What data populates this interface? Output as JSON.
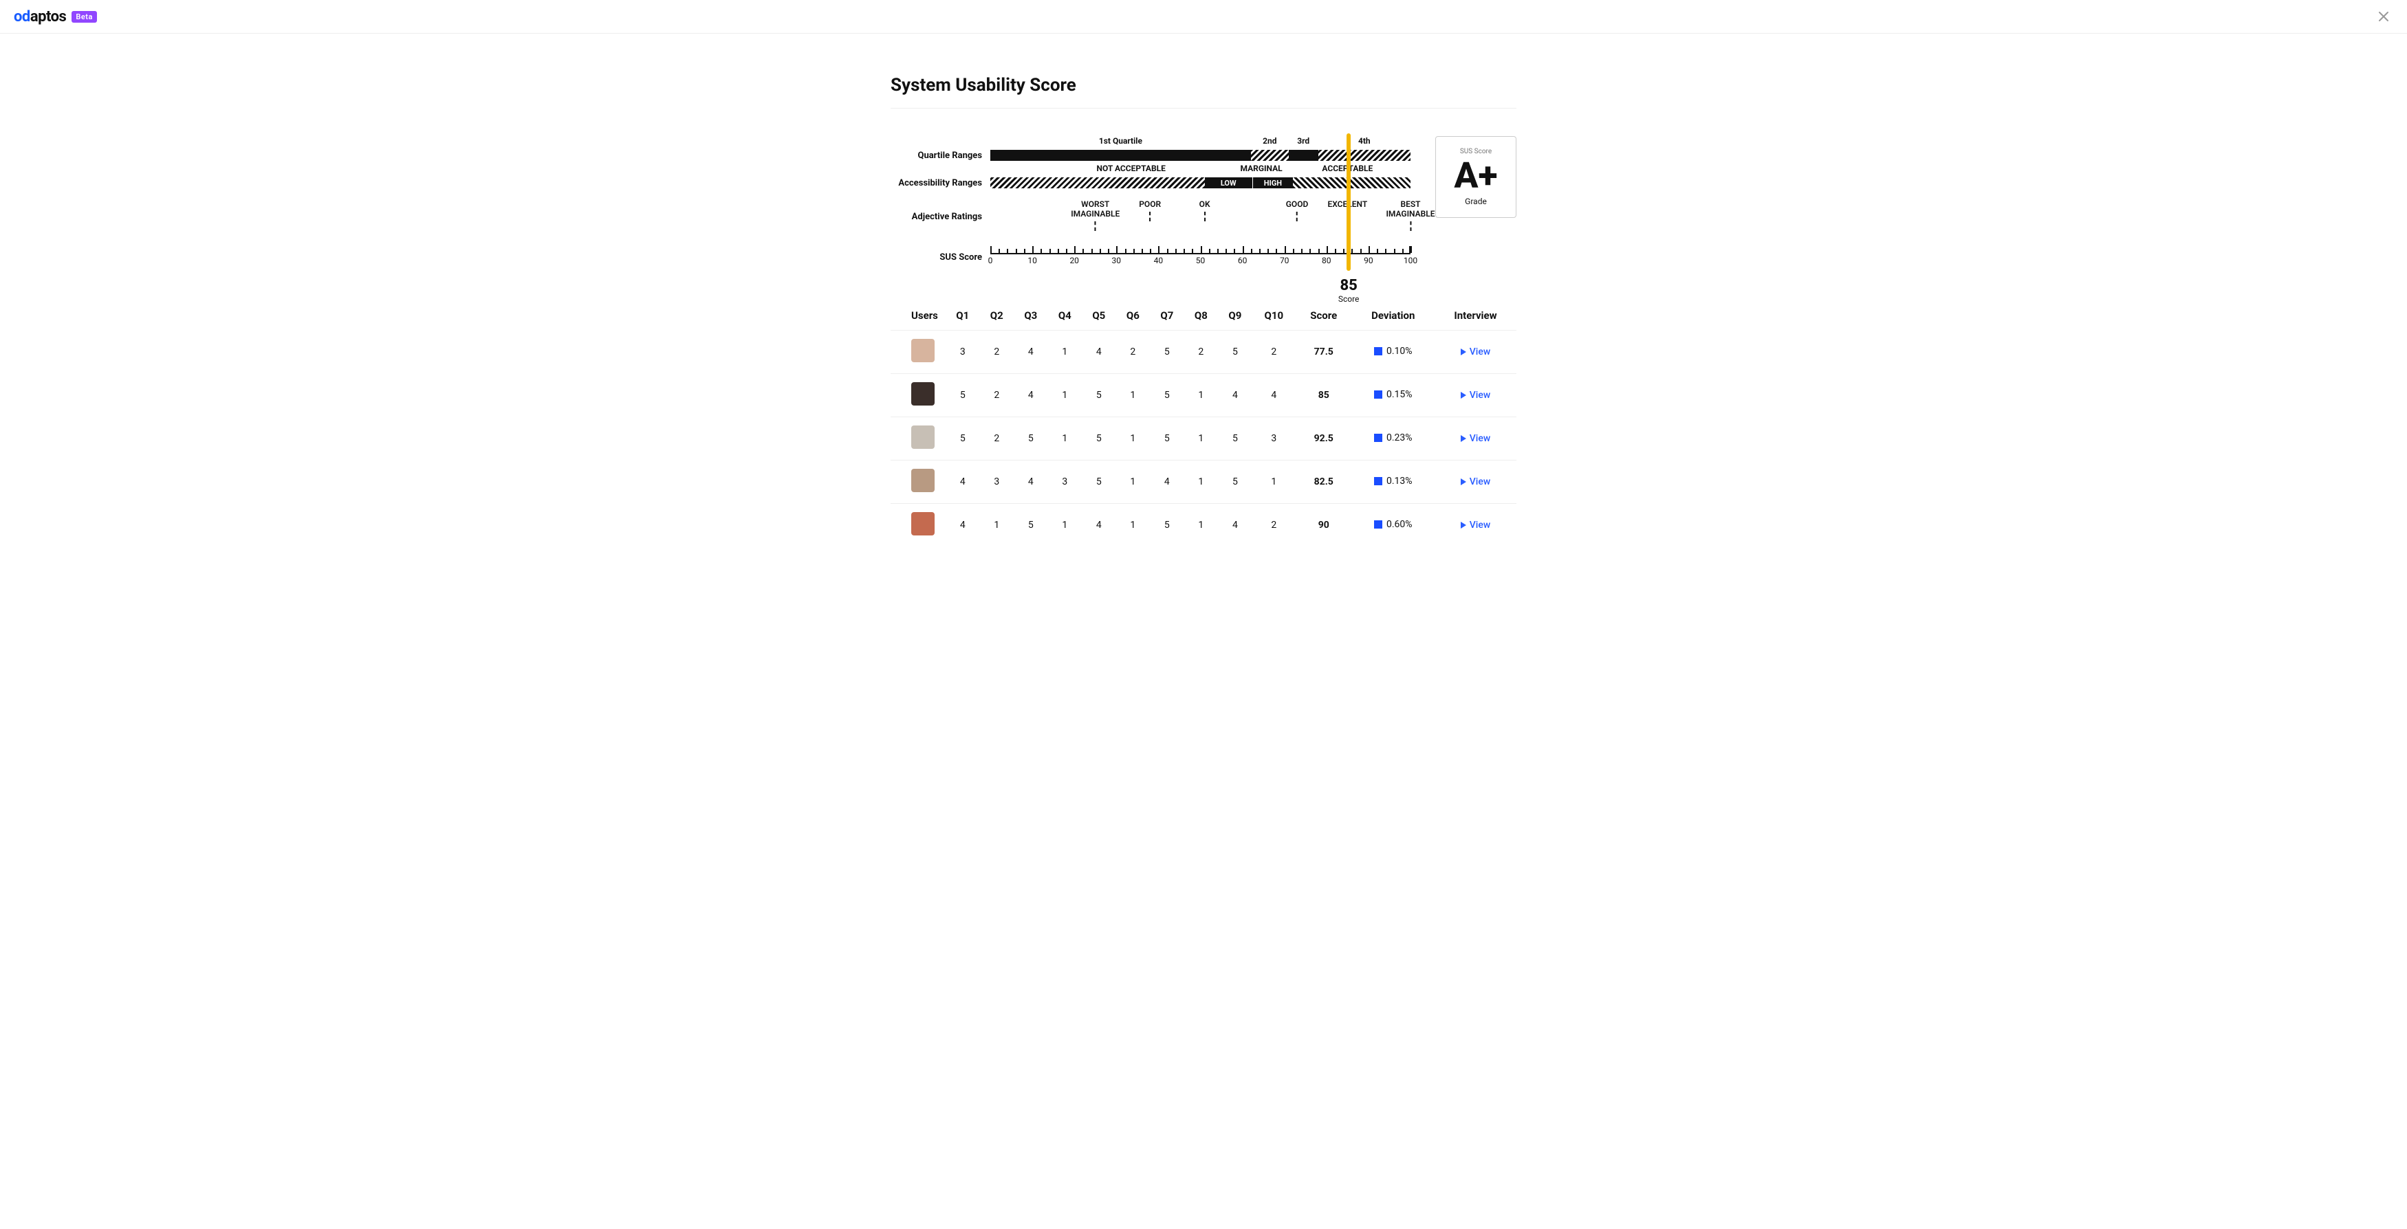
{
  "header": {
    "logo_text": "odaptos",
    "beta_label": "Beta"
  },
  "page_title": "System Usability Score",
  "chart_data": {
    "type": "scale",
    "xlim": [
      0,
      100
    ],
    "ticks": [
      0,
      10,
      20,
      30,
      40,
      50,
      60,
      70,
      80,
      90,
      100
    ],
    "quartile_ranges": {
      "label": "Quartile Ranges",
      "segments": [
        {
          "name": "1st Quartile",
          "start": 0,
          "end": 62,
          "style": "solid"
        },
        {
          "name": "2nd",
          "start": 62,
          "end": 71,
          "style": "hatch"
        },
        {
          "name": "3rd",
          "start": 71,
          "end": 78,
          "style": "solid"
        },
        {
          "name": "4th",
          "start": 78,
          "end": 100,
          "style": "hatch"
        }
      ]
    },
    "accessibility_ranges": {
      "label": "Accessibility Ranges",
      "not_acceptable": {
        "label": "NOT ACCEPTABLE",
        "start": 0,
        "end": 51
      },
      "marginal": {
        "label": "MARGINAL",
        "low": "LOW",
        "high": "HIGH",
        "low_range": [
          51,
          62.5
        ],
        "high_range": [
          62.5,
          72
        ]
      },
      "acceptable": {
        "label": "ACCEPTABLE",
        "start": 72,
        "end": 100
      }
    },
    "adjective_ratings": {
      "label": "Adjective Ratings",
      "items": [
        {
          "label": "WORST\nIMAGINABLE",
          "at": 25
        },
        {
          "label": "POOR",
          "at": 38
        },
        {
          "label": "OK",
          "at": 51
        },
        {
          "label": "GOOD",
          "at": 73
        },
        {
          "label": "EXCELENT",
          "at": 85
        },
        {
          "label": "BEST\nIMAGINABLE",
          "at": 100
        }
      ]
    },
    "axis_label": "SUS Score",
    "marker": {
      "value": 85,
      "caption": "Score"
    }
  },
  "grade": {
    "heading": "SUS Score",
    "value": "A+",
    "caption": "Grade"
  },
  "table": {
    "columns": [
      "Users",
      "Q1",
      "Q2",
      "Q3",
      "Q4",
      "Q5",
      "Q6",
      "Q7",
      "Q8",
      "Q9",
      "Q10",
      "Score",
      "Deviation",
      "Interview"
    ],
    "view_label": "View",
    "rows": [
      {
        "avatar_color": "#d7b49e",
        "q": [
          3,
          2,
          4,
          1,
          4,
          2,
          5,
          2,
          5,
          2
        ],
        "score": "77.5",
        "deviation": "0.10%"
      },
      {
        "avatar_color": "#3a2e2a",
        "q": [
          5,
          2,
          4,
          1,
          5,
          1,
          5,
          1,
          4,
          4
        ],
        "score": "85",
        "deviation": "0.15%"
      },
      {
        "avatar_color": "#c7bfb5",
        "q": [
          5,
          2,
          5,
          1,
          5,
          1,
          5,
          1,
          5,
          3
        ],
        "score": "92.5",
        "deviation": "0.23%"
      },
      {
        "avatar_color": "#b89a82",
        "q": [
          4,
          3,
          4,
          3,
          5,
          1,
          4,
          1,
          5,
          1
        ],
        "score": "82.5",
        "deviation": "0.13%"
      },
      {
        "avatar_color": "#c46a4f",
        "q": [
          4,
          1,
          5,
          1,
          4,
          1,
          5,
          1,
          4,
          2
        ],
        "score": "90",
        "deviation": "0.60%"
      }
    ]
  }
}
